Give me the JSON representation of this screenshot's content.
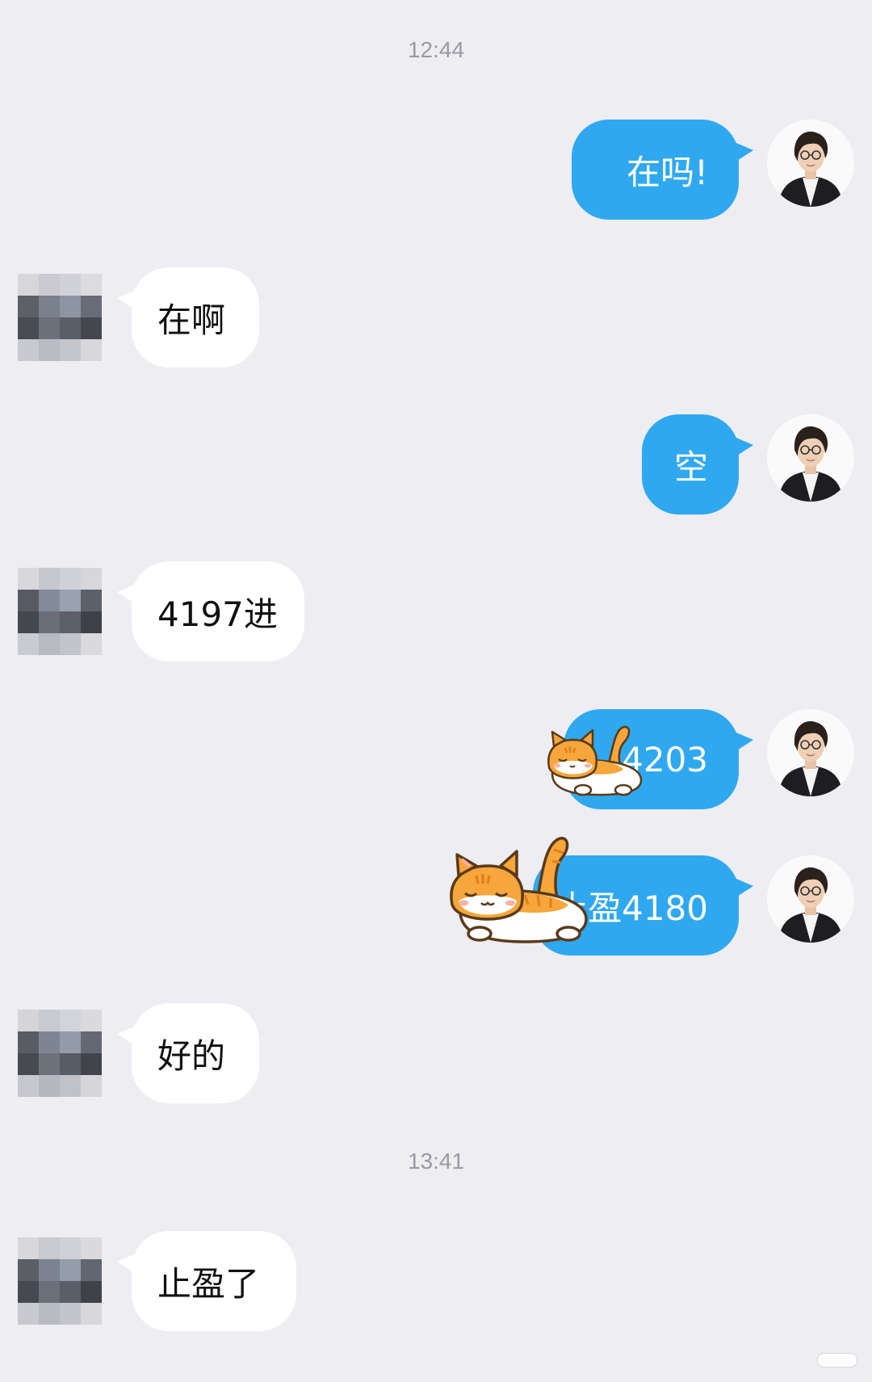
{
  "timestamps": [
    "12:44",
    "13:41"
  ],
  "messages": [
    {
      "side": "right",
      "text": "在吗!"
    },
    {
      "side": "left",
      "text": "在啊"
    },
    {
      "side": "right",
      "text": "空"
    },
    {
      "side": "left",
      "text": "4197进"
    },
    {
      "side": "right",
      "text": "4203",
      "prefix_hidden_by_sticker": true
    },
    {
      "side": "right",
      "text": "止盈4180"
    },
    {
      "side": "left",
      "text": "好的"
    },
    {
      "side": "left",
      "text": "止盈了"
    }
  ],
  "icons": {
    "self_avatar": "woman-portrait-avatar",
    "other_avatar": "pixelated-avatar",
    "sticker": "sleeping-orange-cat-sticker"
  },
  "colors": {
    "background": "#ededf2",
    "sent_bubble": "#2fa8ef",
    "received_bubble": "#ffffff",
    "timestamp": "#9a9aa3"
  }
}
